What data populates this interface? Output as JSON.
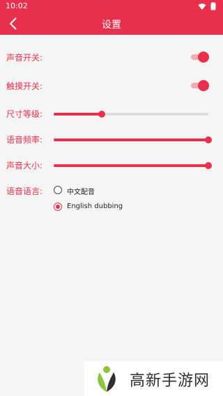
{
  "status_bar": {
    "time": "10:02",
    "icons": [
      "wifi-icon",
      "battery-icon"
    ]
  },
  "app_bar": {
    "title": "设置",
    "back_icon": "chevron-left-icon"
  },
  "settings": {
    "sound": {
      "label": "声音开关:",
      "on": true
    },
    "touch": {
      "label": "触摸开关:",
      "on": true
    },
    "size": {
      "label": "尺寸等级:",
      "value": 0.31
    },
    "frequency": {
      "label": "语音频率:",
      "value": 1.0
    },
    "volume": {
      "label": "声音大小:",
      "value": 1.0
    },
    "language": {
      "label": "语音语言:",
      "options": [
        {
          "label": "中文配音",
          "selected": false
        },
        {
          "label": "English dubbing",
          "selected": true
        }
      ]
    }
  },
  "watermark": {
    "text": "高新手游网"
  },
  "colors": {
    "accent": "#e8304c",
    "accent_light": "#f2a9b3",
    "background": "#f5f5f5"
  }
}
